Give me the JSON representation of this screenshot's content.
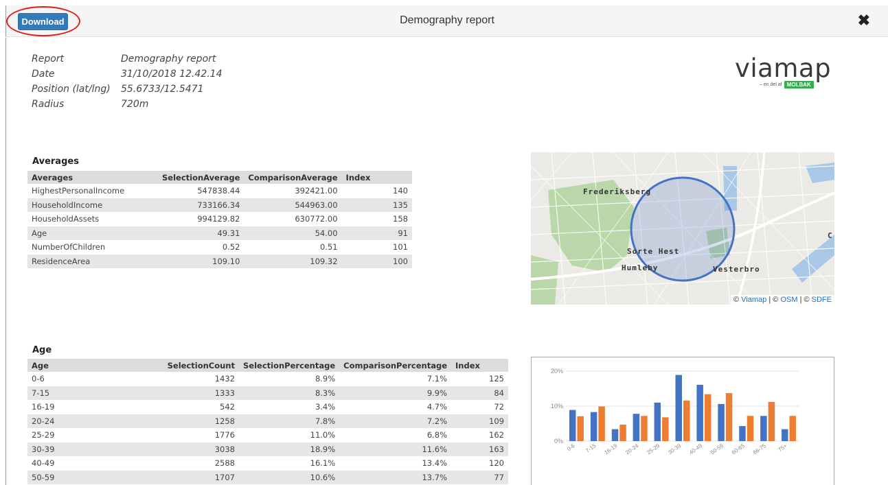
{
  "header": {
    "download_label": "Download",
    "title": "Demography report",
    "close_glyph": "✖"
  },
  "info": [
    {
      "key": "Report",
      "value": "Demography report"
    },
    {
      "key": "Date",
      "value": "31/10/2018 12.42.14"
    },
    {
      "key": "Position (lat/lng)",
      "value": "55.6733/12.5471"
    },
    {
      "key": "Radius",
      "value": "720m"
    }
  ],
  "logo": {
    "word": "viamap",
    "sub_text": "– en del af",
    "brand": "MOLBAK"
  },
  "averages": {
    "section_title": "Averages",
    "headers": [
      "Averages",
      "SelectionAverage",
      "ComparisonAverage",
      "Index"
    ],
    "rows": [
      [
        "HighestPersonalIncome",
        "547838.44",
        "392421.00",
        "140"
      ],
      [
        "HouseholdIncome",
        "733166.34",
        "544963.00",
        "135"
      ],
      [
        "HouseholdAssets",
        "994129.82",
        "630772.00",
        "158"
      ],
      [
        "Age",
        "49.31",
        "54.00",
        "91"
      ],
      [
        "NumberOfChildren",
        "0.52",
        "0.51",
        "101"
      ],
      [
        "ResidenceArea",
        "109.10",
        "109.32",
        "100"
      ]
    ]
  },
  "map": {
    "labels": [
      "Frederiksberg",
      "Sorte Hest",
      "Humleby",
      "Vesterbro",
      "C"
    ],
    "attribution": {
      "prefix": "©",
      "viamap": "Viamap",
      "sep1": "| ©",
      "osm": "OSM",
      "sep2": "| ©",
      "sdfe": "SDFE"
    },
    "colors": {
      "circle": "#4472c4",
      "park": "#b9d7a8",
      "water": "#a9c8e8"
    }
  },
  "age": {
    "section_title": "Age",
    "headers": [
      "Age",
      "SelectionCount",
      "SelectionPercentage",
      "ComparisonPercentage",
      "Index"
    ],
    "rows": [
      [
        "0-6",
        "1432",
        "8.9%",
        "7.1%",
        "125"
      ],
      [
        "7-15",
        "1333",
        "8.3%",
        "9.9%",
        "84"
      ],
      [
        "16-19",
        "542",
        "3.4%",
        "4.7%",
        "72"
      ],
      [
        "20-24",
        "1258",
        "7.8%",
        "7.2%",
        "109"
      ],
      [
        "25-29",
        "1776",
        "11.0%",
        "6.8%",
        "162"
      ],
      [
        "30-39",
        "3038",
        "18.9%",
        "11.6%",
        "163"
      ],
      [
        "40-49",
        "2588",
        "16.1%",
        "13.4%",
        "120"
      ],
      [
        "50-59",
        "1707",
        "10.6%",
        "13.7%",
        "77"
      ]
    ]
  },
  "chart_data": {
    "type": "bar",
    "categories": [
      "0-6",
      "7-15",
      "16-19",
      "20-24",
      "25-29",
      "30-39",
      "40-49",
      "50-59",
      "60-65",
      "66-75",
      "75+"
    ],
    "series": [
      {
        "values": [
          8.9,
          8.3,
          3.4,
          7.8,
          11.0,
          18.9,
          16.1,
          10.6,
          4.3,
          7.2,
          3.4
        ],
        "color": "#4472c4"
      },
      {
        "values": [
          7.1,
          9.9,
          4.7,
          7.2,
          6.8,
          11.6,
          13.4,
          13.7,
          7.2,
          11.2,
          7.2
        ],
        "color": "#ed7d31"
      }
    ],
    "yticks": [
      "0%",
      "10%",
      "20%"
    ],
    "ylim": [
      0,
      20
    ],
    "grid": true
  }
}
